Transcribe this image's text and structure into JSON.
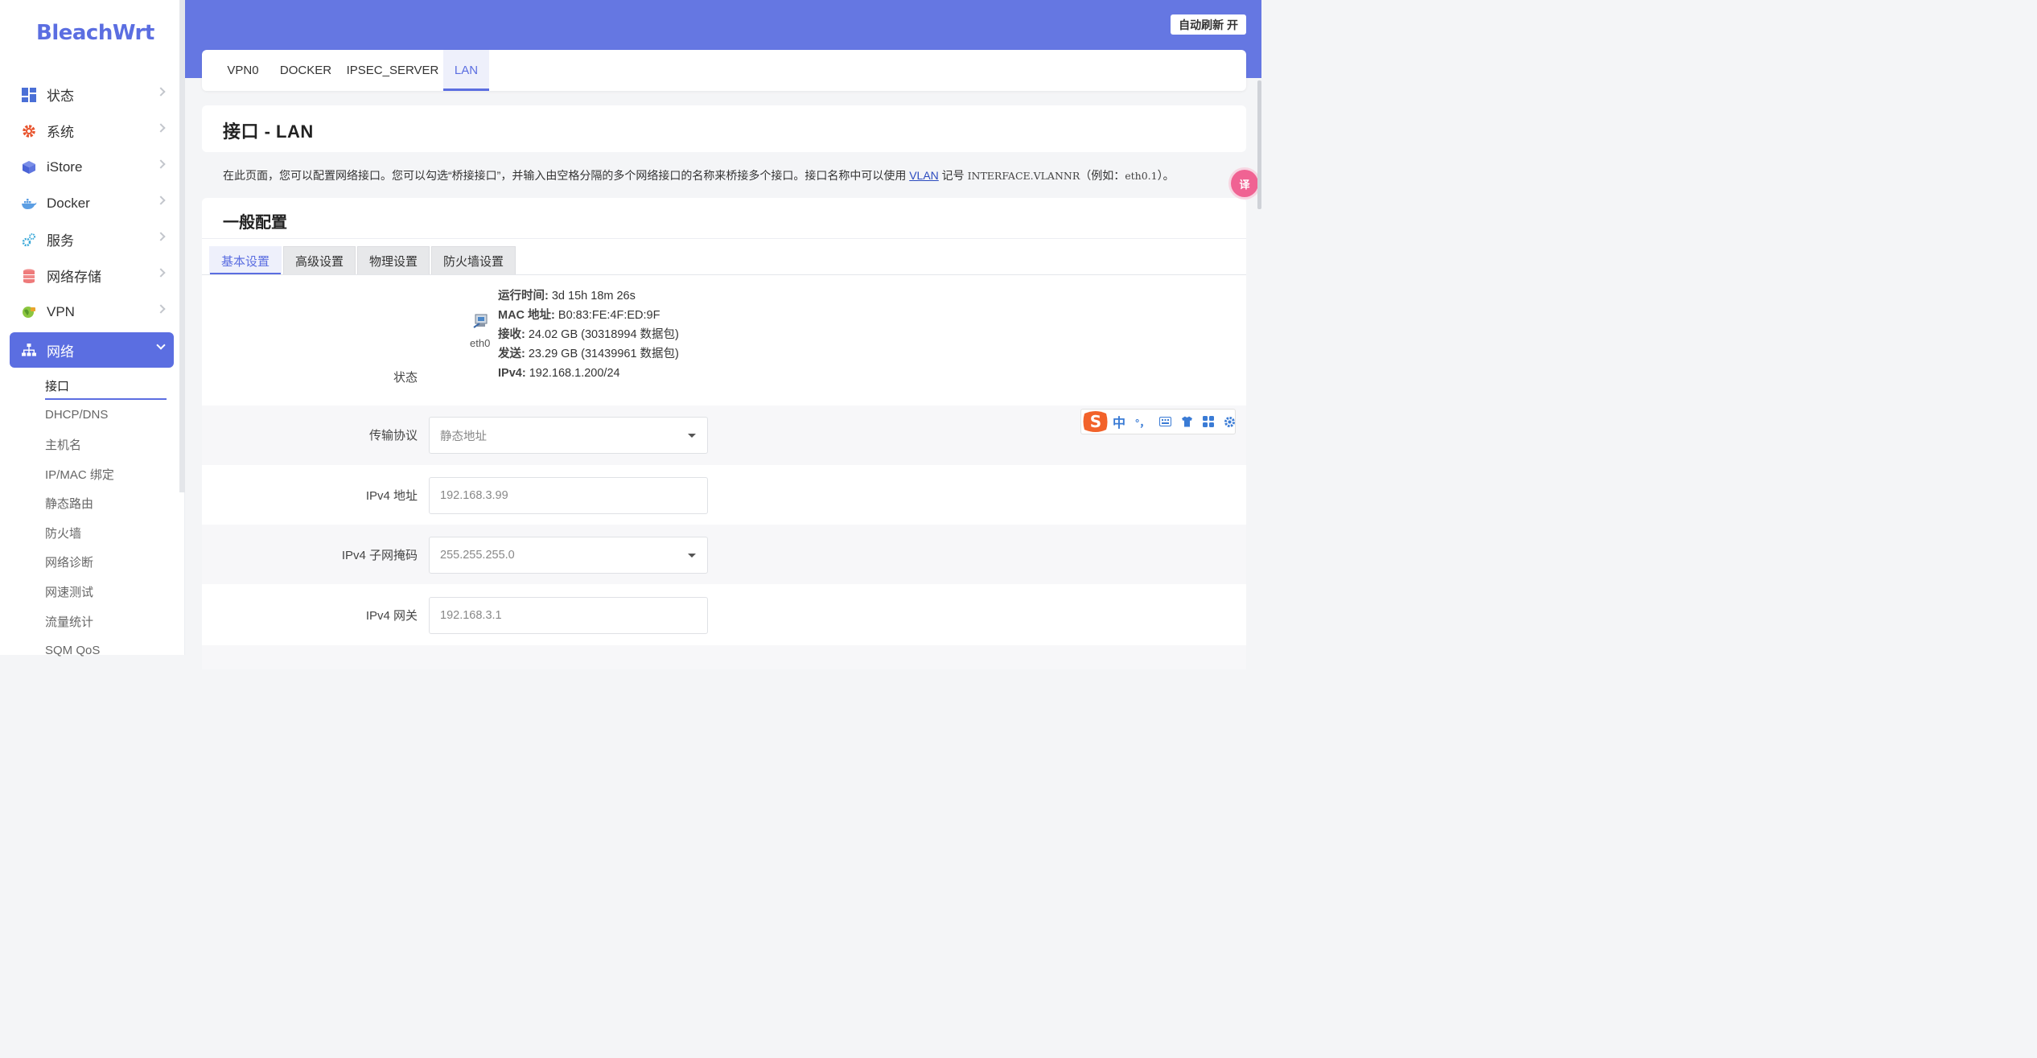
{
  "brand": "BleachWrt",
  "header": {
    "auto_refresh": "自动刷新 开"
  },
  "sidebar": {
    "items": [
      {
        "label": "状态"
      },
      {
        "label": "系统"
      },
      {
        "label": "iStore"
      },
      {
        "label": "Docker"
      },
      {
        "label": "服务"
      },
      {
        "label": "网络存储"
      },
      {
        "label": "VPN"
      },
      {
        "label": "网络"
      }
    ],
    "sub_items": [
      {
        "label": "接口"
      },
      {
        "label": "DHCP/DNS"
      },
      {
        "label": "主机名"
      },
      {
        "label": "IP/MAC 绑定"
      },
      {
        "label": "静态路由"
      },
      {
        "label": "防火墙"
      },
      {
        "label": "网络诊断"
      },
      {
        "label": "网速测试"
      },
      {
        "label": "流量统计"
      },
      {
        "label": "SQM QoS"
      }
    ]
  },
  "tabs": [
    {
      "label": "VPN0"
    },
    {
      "label": "DOCKER"
    },
    {
      "label": "IPSEC_SERVER"
    },
    {
      "label": "LAN"
    }
  ],
  "page": {
    "title": "接口 - LAN",
    "desc_a": "在此页面，您可以配置网络接口。您可以勾选“桥接接口”，并输入由空格分隔的多个网络接口的名称来桥接多个接口。接口名称中可以使用 ",
    "desc_link": "VLAN",
    "desc_b": " 记号 ",
    "desc_code": "INTERFACE.VLANNR",
    "desc_c": "（例如：",
    "desc_code2": "eth0.1",
    "desc_d": "）。"
  },
  "general": {
    "title": "一般配置",
    "subtabs": [
      {
        "label": "基本设置"
      },
      {
        "label": "高级设置"
      },
      {
        "label": "物理设置"
      },
      {
        "label": "防火墙设置"
      }
    ],
    "status": {
      "label": "状态",
      "device": "eth0",
      "uptime_label": "运行时间:",
      "uptime": " 3d 15h 18m 26s",
      "mac_label": "MAC 地址:",
      "mac": " B0:83:FE:4F:ED:9F",
      "rx_label": "接收:",
      "rx": " 24.02 GB (30318994 数据包)",
      "tx_label": "发送:",
      "tx": " 23.29 GB (31439961 数据包)",
      "ipv4_label": "IPv4:",
      "ipv4": " 192.168.1.200/24"
    },
    "fields": {
      "protocol_label": "传输协议",
      "protocol_value": "静态地址",
      "ipv4_addr_label": "IPv4 地址",
      "ipv4_addr_value": "192.168.3.99",
      "netmask_label": "IPv4 子网掩码",
      "netmask_value": "255.255.255.0",
      "gateway_label": "IPv4 网关",
      "gateway_value": "192.168.3.1"
    }
  },
  "ime": {
    "lang": "中",
    "punct": "°，"
  },
  "float_button": "译"
}
